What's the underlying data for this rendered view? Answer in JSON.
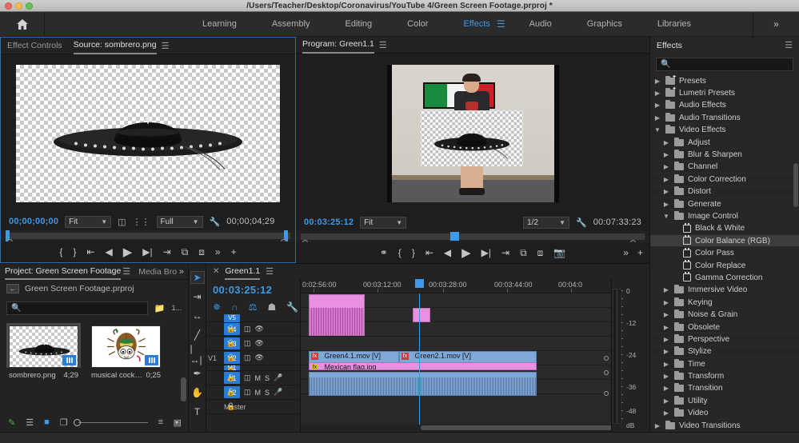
{
  "window": {
    "title": "/Users/Teacher/Desktop/Coronavirus/YouTube 4/Green Screen Footage.prproj *",
    "traffic": [
      "close",
      "minimize",
      "zoom"
    ]
  },
  "workspace": {
    "home_icon": "home-icon",
    "tabs": [
      {
        "label": "Learning",
        "active": false
      },
      {
        "label": "Assembly",
        "active": false
      },
      {
        "label": "Editing",
        "active": false
      },
      {
        "label": "Color",
        "active": false
      },
      {
        "label": "Effects",
        "active": true
      },
      {
        "label": "Audio",
        "active": false
      },
      {
        "label": "Graphics",
        "active": false
      },
      {
        "label": "Libraries",
        "active": false
      }
    ],
    "overflow": "»"
  },
  "source_monitor": {
    "tabs": [
      {
        "label": "Effect Controls",
        "active": false
      },
      {
        "label": "Source: sombrero.png",
        "active": true
      }
    ],
    "menu_icon": "panel-menu-icon",
    "playhead_timecode": "00;00;00;00",
    "fit_value": "Fit",
    "quality_value": "Full",
    "duration_timecode": "00;00;04;29",
    "settings_icon": "wrench-icon",
    "buttons": [
      "mark-in",
      "mark-out",
      "go-to-in",
      "step-back",
      "play",
      "step-forward",
      "go-to-out",
      "insert",
      "overwrite",
      "export-frame",
      "button-editor"
    ]
  },
  "program_monitor": {
    "tab": "Program: Green1.1",
    "menu_icon": "panel-menu-icon",
    "playhead_timecode": "00:03:25:12",
    "fit_value": "Fit",
    "resolution_value": "1/2",
    "duration_timecode": "00:07:33:23",
    "settings_icon": "wrench-icon",
    "buttons": [
      "add-marker",
      "mark-in",
      "mark-out",
      "go-to-in",
      "step-back",
      "play",
      "step-forward",
      "go-to-out",
      "lift",
      "extract",
      "export-frame",
      "button-editor"
    ]
  },
  "project_panel": {
    "tabs": [
      {
        "label": "Project: Green Screen Footage",
        "active": true
      },
      {
        "label": "Media Bro",
        "active": false
      }
    ],
    "menu_icon": "panel-menu-icon",
    "overflow": "»",
    "breadcrumb": "Green Screen Footage.prproj",
    "search_placeholder": "",
    "item_count": "1...",
    "items": [
      {
        "name": "sombrero.png",
        "duration": "4;29",
        "selected": true,
        "kind": "image"
      },
      {
        "name": "musical cockroach...",
        "duration": "0;25",
        "selected": false,
        "kind": "image"
      }
    ],
    "footer_icons": [
      "new-item-pen-icon",
      "list-view-icon",
      "icon-view-icon",
      "freeform-view-icon",
      "zoom-slider",
      "sort-icon",
      "chevron-down-icon",
      "more-icon"
    ]
  },
  "tools": [
    {
      "name": "selection-tool",
      "glyph": "➤",
      "active": true
    },
    {
      "name": "track-select-forward-tool",
      "glyph": "⇥",
      "active": false
    },
    {
      "name": "ripple-edit-tool",
      "glyph": "↔",
      "active": false
    },
    {
      "name": "razor-tool",
      "glyph": "∕",
      "active": false
    },
    {
      "name": "slip-tool",
      "glyph": "⇔",
      "active": false
    },
    {
      "name": "pen-tool",
      "glyph": "✎",
      "active": false
    },
    {
      "name": "hand-tool",
      "glyph": "✋",
      "active": false
    },
    {
      "name": "type-tool",
      "glyph": "T",
      "active": false
    }
  ],
  "timeline": {
    "tab": "Green1.1",
    "close_icon": "close-icon",
    "menu_icon": "panel-menu-icon",
    "playhead_timecode": "00:03:25:12",
    "tool_icons": [
      "insert-overwrite-icon",
      "snap-icon",
      "linked-selection-icon",
      "marker-icon",
      "timeline-settings-icon"
    ],
    "ruler_labels": [
      "0:02:56:00",
      "00:03:12:00",
      "00:03:28:00",
      "00:03:44:00",
      "00:04:0"
    ],
    "tracks": [
      {
        "name": "V5",
        "type": "video"
      },
      {
        "name": "V4",
        "type": "video"
      },
      {
        "name": "V3",
        "type": "video"
      },
      {
        "name": "V2",
        "type": "video"
      },
      {
        "name": "V1",
        "type": "video",
        "left_label": "V1"
      },
      {
        "name": "A1",
        "type": "audio"
      },
      {
        "name": "A2",
        "type": "audio"
      },
      {
        "name": "Master",
        "type": "master"
      }
    ],
    "track_controls": {
      "lock": "M",
      "mute": "M",
      "solo": "S",
      "voice": "mic-icon",
      "eye": "eye-icon",
      "sync": "sync-lock-icon"
    },
    "clips": [
      {
        "label": "Green4.1.mov [V]",
        "track": "V1",
        "color": "blue"
      },
      {
        "label": "Green2.1.mov [V]",
        "track": "V1",
        "color": "blue"
      },
      {
        "label": "Mexican flag.jpg",
        "track": "V1-below",
        "color": "pink"
      }
    ],
    "audio_meter": {
      "labels": [
        "0",
        "-12",
        "-24",
        "-36",
        "-48",
        "dB"
      ]
    }
  },
  "effects_panel": {
    "title": "Effects",
    "menu_icon": "panel-menu-icon",
    "search_placeholder": "",
    "search_icon": "search-icon",
    "rows": [
      {
        "label": "Presets",
        "depth": 0,
        "state": "collapsed",
        "type": "folder-star"
      },
      {
        "label": "Lumetri Presets",
        "depth": 0,
        "state": "collapsed",
        "type": "folder-star"
      },
      {
        "label": "Audio Effects",
        "depth": 0,
        "state": "collapsed",
        "type": "folder"
      },
      {
        "label": "Audio Transitions",
        "depth": 0,
        "state": "collapsed",
        "type": "folder"
      },
      {
        "label": "Video Effects",
        "depth": 0,
        "state": "expanded",
        "type": "folder"
      },
      {
        "label": "Adjust",
        "depth": 1,
        "state": "collapsed",
        "type": "folder"
      },
      {
        "label": "Blur & Sharpen",
        "depth": 1,
        "state": "collapsed",
        "type": "folder"
      },
      {
        "label": "Channel",
        "depth": 1,
        "state": "collapsed",
        "type": "folder"
      },
      {
        "label": "Color Correction",
        "depth": 1,
        "state": "collapsed",
        "type": "folder"
      },
      {
        "label": "Distort",
        "depth": 1,
        "state": "collapsed",
        "type": "folder"
      },
      {
        "label": "Generate",
        "depth": 1,
        "state": "collapsed",
        "type": "folder"
      },
      {
        "label": "Image Control",
        "depth": 1,
        "state": "expanded",
        "type": "folder"
      },
      {
        "label": "Black & White",
        "depth": 2,
        "state": "leaf",
        "type": "effect"
      },
      {
        "label": "Color Balance (RGB)",
        "depth": 2,
        "state": "leaf",
        "type": "effect",
        "selected": true
      },
      {
        "label": "Color Pass",
        "depth": 2,
        "state": "leaf",
        "type": "effect"
      },
      {
        "label": "Color Replace",
        "depth": 2,
        "state": "leaf",
        "type": "effect"
      },
      {
        "label": "Gamma Correction",
        "depth": 2,
        "state": "leaf",
        "type": "effect"
      },
      {
        "label": "Immersive Video",
        "depth": 1,
        "state": "collapsed",
        "type": "folder"
      },
      {
        "label": "Keying",
        "depth": 1,
        "state": "collapsed",
        "type": "folder"
      },
      {
        "label": "Noise & Grain",
        "depth": 1,
        "state": "collapsed",
        "type": "folder"
      },
      {
        "label": "Obsolete",
        "depth": 1,
        "state": "collapsed",
        "type": "folder"
      },
      {
        "label": "Perspective",
        "depth": 1,
        "state": "collapsed",
        "type": "folder"
      },
      {
        "label": "Stylize",
        "depth": 1,
        "state": "collapsed",
        "type": "folder"
      },
      {
        "label": "Time",
        "depth": 1,
        "state": "collapsed",
        "type": "folder"
      },
      {
        "label": "Transform",
        "depth": 1,
        "state": "collapsed",
        "type": "folder"
      },
      {
        "label": "Transition",
        "depth": 1,
        "state": "collapsed",
        "type": "folder"
      },
      {
        "label": "Utility",
        "depth": 1,
        "state": "collapsed",
        "type": "folder"
      },
      {
        "label": "Video",
        "depth": 1,
        "state": "collapsed",
        "type": "folder"
      },
      {
        "label": "Video Transitions",
        "depth": 0,
        "state": "collapsed",
        "type": "folder"
      }
    ]
  },
  "colors": {
    "accent_blue": "#3c9ae8",
    "track_blue": "#2b7cd3",
    "clip_pink": "#e88fe0",
    "clip_blue": "#7fa8d8",
    "panel_bg": "#232323"
  }
}
